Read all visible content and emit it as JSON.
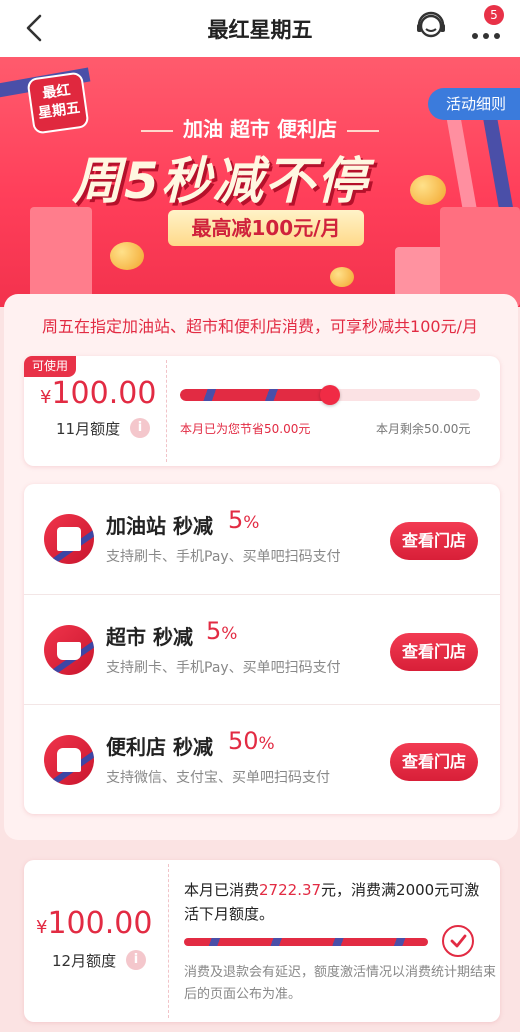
{
  "header": {
    "title": "最红星期五",
    "badge_count": "5",
    "icons": {
      "back": "back-arrow-icon",
      "service": "customer-service-icon",
      "more": "more-dots-icon"
    }
  },
  "banner": {
    "logo_line1": "最红",
    "logo_line2": "星期五",
    "activity_rules": "活动细则",
    "subtitle": "加油 超市 便利店",
    "headline": "周5秒减不停",
    "pill": "最高减100元/月"
  },
  "notice": "周五在指定加油站、超市和便利店消费，可享秒减共100元/月",
  "current_quota": {
    "tag": "可使用",
    "currency": "¥",
    "amount": "100.00",
    "month_label": "11月额度",
    "info_icon": "i",
    "saved_text": "本月已为您节省50.00元",
    "remaining_text": "本月剩余50.00元",
    "progress": 0.5
  },
  "stores": [
    {
      "name": "加油站 秒减",
      "percent": "5",
      "percent_sign": "%",
      "desc": "支持刷卡、手机Pay、买单吧扫码支付",
      "button": "查看门店",
      "icon": "gas-station-icon"
    },
    {
      "name": "超市 秒减",
      "percent": "5",
      "percent_sign": "%",
      "desc": "支持刷卡、手机Pay、买单吧扫码支付",
      "button": "查看门店",
      "icon": "shopping-basket-icon"
    },
    {
      "name": "便利店 秒减",
      "percent": "50",
      "percent_sign": "%",
      "desc": "支持微信、支付宝、买单吧扫码支付",
      "button": "查看门店",
      "icon": "convenience-store-icon"
    }
  ],
  "next_quota": {
    "currency": "¥",
    "amount": "100.00",
    "month_label": "12月额度",
    "info_icon": "i",
    "spent_prefix": "本月已消费",
    "spent_value": "2722.37",
    "spent_suffix": "元，消费满2000元可激活下月额度。",
    "note": "消费及退款会有延迟，额度激活情况以消费统计期结束后的页面公布为准。",
    "progress": 1.0
  },
  "colors": {
    "accent": "#e22b43",
    "secondary": "#4a4fa8",
    "link_blue": "#3b7bdc"
  }
}
